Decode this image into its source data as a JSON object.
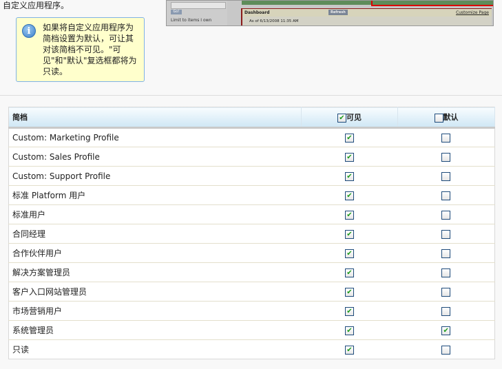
{
  "intro_text": "自定义应用程序。",
  "tip": {
    "icon": "info-icon",
    "text": "如果将自定义应用程序为简档设置为默认，可让其对该简档不可见。\"可见\"和\"默认\"复选框都将为只读。"
  },
  "screenshot": {
    "go": "Go!",
    "limit": "Limit to items I own",
    "dashboard": "Dashboard",
    "refresh": "Refresh",
    "customize": "Customize Page",
    "as_of": "As of 6/13/2008 11:35 AM"
  },
  "table": {
    "headers": {
      "profile": "简档",
      "visible": "可见",
      "default": "默认"
    },
    "header_visible_checked": true,
    "header_default_checked": false,
    "rows": [
      {
        "name": "Custom: Marketing Profile",
        "visible": true,
        "default": false
      },
      {
        "name": "Custom: Sales Profile",
        "visible": true,
        "default": false
      },
      {
        "name": "Custom: Support Profile",
        "visible": true,
        "default": false
      },
      {
        "name": "标准 Platform 用户",
        "visible": true,
        "default": false
      },
      {
        "name": "标准用户",
        "visible": true,
        "default": false
      },
      {
        "name": "合同经理",
        "visible": true,
        "default": false
      },
      {
        "name": "合作伙伴用户",
        "visible": true,
        "default": false
      },
      {
        "name": "解决方案管理员",
        "visible": true,
        "default": false
      },
      {
        "name": "客户入口网站管理员",
        "visible": true,
        "default": false
      },
      {
        "name": "市场营销用户",
        "visible": true,
        "default": false
      },
      {
        "name": "系统管理员",
        "visible": true,
        "default": true
      },
      {
        "name": "只读",
        "visible": true,
        "default": false
      }
    ]
  }
}
